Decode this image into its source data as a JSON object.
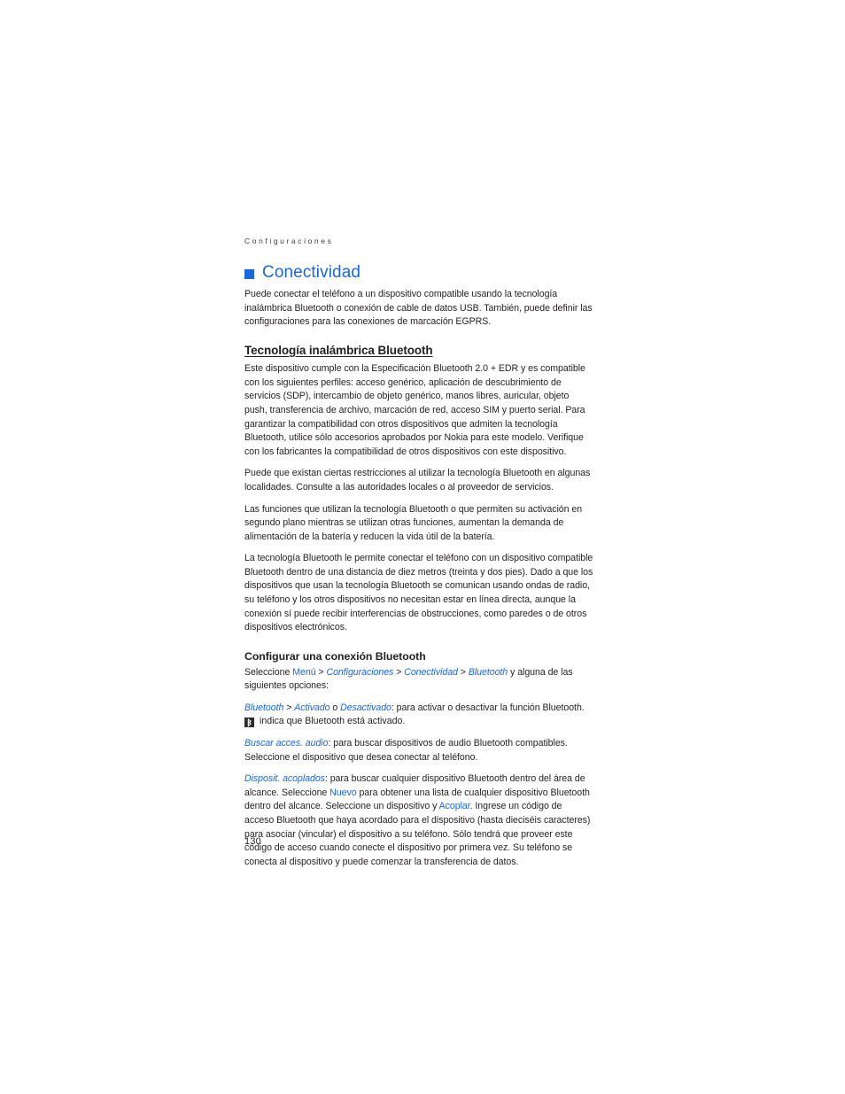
{
  "page": {
    "running_header": "Configuraciones",
    "folio": "130",
    "accent_color": "#1668e3",
    "text_color": "#231f20"
  },
  "chapter": {
    "bullet_icon": "square-bullet-icon",
    "title": "Conectividad",
    "intro": "Puede conectar el teléfono a un dispositivo compatible usando la tecnología inalámbrica Bluetooth o conexión de cable de datos USB. También, puede definir las configuraciones para las conexiones de marcación EGPRS."
  },
  "section_bluetooth": {
    "heading": "Tecnología inalámbrica Bluetooth",
    "paragraphs": [
      "Este dispositivo cumple con la Especificación Bluetooth 2.0 + EDR y es compatible con los siguientes perfiles: acceso genérico, aplicación de descubrimiento de servicios (SDP), intercambio de objeto genérico, manos libres, auricular, objeto push, transferencia de archivo, marcación de red, acceso SIM y puerto serial. Para garantizar la compatibilidad con otros dispositivos que admiten la tecnología Bluetooth, utilice sólo accesorios aprobados por Nokia para este modelo. Verifique con los fabricantes la compatibilidad de otros dispositivos con este dispositivo.",
      "Puede que existan ciertas restricciones al utilizar la tecnología Bluetooth en algunas localidades. Consulte a las autoridades locales o al proveedor de servicios.",
      "Las funciones que utilizan la tecnología Bluetooth o que permiten su activación en segundo plano mientras se utilizan otras funciones, aumentan la demanda de alimentación de la batería y reducen la vida útil de la batería.",
      "La tecnología Bluetooth le permite conectar el teléfono con un dispositivo compatible Bluetooth dentro de una distancia de diez metros (treinta y dos pies). Dado a que los dispositivos que usan la tecnología Bluetooth se comunican usando ondas de radio, su teléfono y los otros dispositivos no necesitan estar en línea directa, aunque la conexión sí puede recibir interferencias de obstrucciones, como paredes o de otros dispositivos electrónicos."
    ]
  },
  "section_configurar": {
    "heading": "Configurar una conexión Bluetooth",
    "path_intro": "Seleccione ",
    "path_menu": "Menú",
    "path_sep": " > ",
    "path_configuraciones": "Configuraciones",
    "path_conectividad": "Conectividad",
    "path_bluetooth": "Bluetooth",
    "path_tail": " y alguna de las siguientes opciones:",
    "option_bluetooth": {
      "label": "Bluetooth",
      "sep": " > ",
      "value_on": "Activado",
      "conjunction": " o ",
      "value_off": "Desactivado",
      "description": ": para activar o desactivar la función Bluetooth.",
      "icon_name": "bluetooth-icon",
      "icon_note": "indica que Bluetooth está activado."
    },
    "option_buscar_audio": {
      "label": "Buscar acces. audio",
      "description": ": para buscar dispositivos de audio Bluetooth compatibles. Seleccione el dispositivo que desea conectar al teléfono."
    },
    "option_disposit_acoplados": {
      "label": "Disposit. acoplados",
      "description_part1": ": para buscar cualquier dispositivo Bluetooth dentro del área de alcance. Seleccione ",
      "link_nuevo": "Nuevo",
      "description_part2": " para obtener una lista de cualquier dispositivo Bluetooth dentro del alcance. Seleccione un dispositivo y ",
      "link_acoplar": "Acoplar",
      "description_part3": ". Ingrese un código de acceso Bluetooth que haya acordado para el dispositivo (hasta dieciséis caracteres) para asociar (vincular) el dispositivo a su teléfono. Sólo tendrá que proveer este código de acceso cuando conecte el dispositivo por primera vez. Su teléfono se conecta al dispositivo y puede comenzar la transferencia de datos."
    }
  }
}
